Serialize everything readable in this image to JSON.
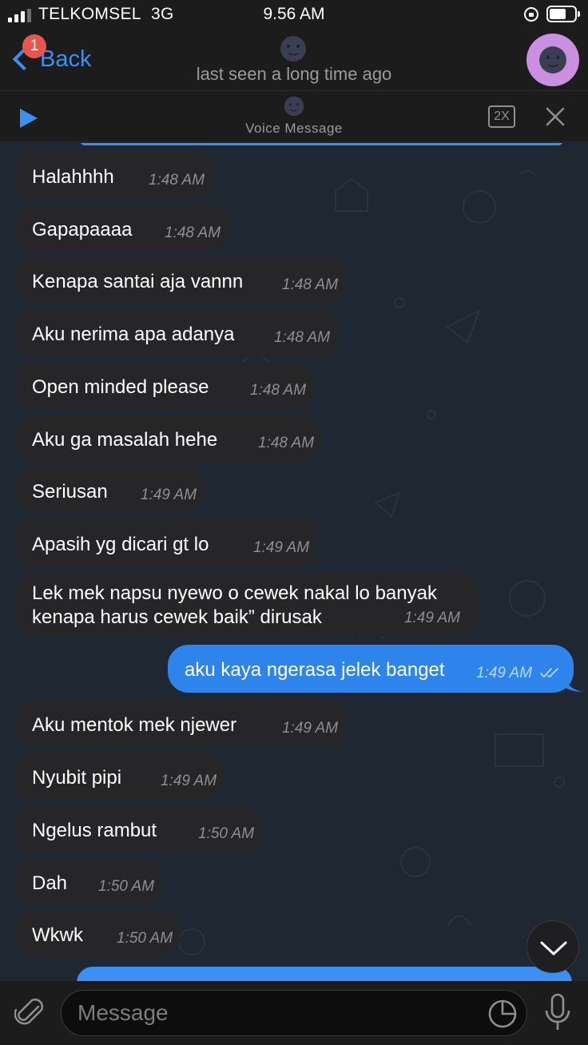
{
  "status_bar": {
    "carrier": "TELKOMSEL",
    "network": "3G",
    "time": "9.56 AM",
    "icons": [
      "signal-icon",
      "orientation-lock-icon",
      "battery-icon"
    ]
  },
  "nav": {
    "back_label": "Back",
    "unread_badge": "1",
    "contact_emoji": "🌚",
    "status": "last seen a long time ago",
    "avatar_emoji": "🌚"
  },
  "voice_bar": {
    "emoji": "🌚",
    "label": "Voice Message",
    "speed": "2X",
    "icons": [
      "play-icon",
      "close-icon"
    ]
  },
  "messages": [
    {
      "dir": "in",
      "text": "Halahhhh",
      "time": "1:48 AM"
    },
    {
      "dir": "in",
      "text": "Gapapaaaa",
      "time": "1:48 AM"
    },
    {
      "dir": "in",
      "text": "Kenapa santai aja vannn",
      "time": "1:48 AM"
    },
    {
      "dir": "in",
      "text": "Aku nerima apa adanya",
      "time": "1:48 AM"
    },
    {
      "dir": "in",
      "text": "Open minded please",
      "time": "1:48 AM"
    },
    {
      "dir": "in",
      "text": "Aku ga masalah hehe",
      "time": "1:48 AM"
    },
    {
      "dir": "in",
      "text": "Seriusan",
      "time": "1:49 AM"
    },
    {
      "dir": "in",
      "text": "Apasih yg dicari gt lo",
      "time": "1:49 AM"
    },
    {
      "dir": "in",
      "line1": "Lek mek napsu nyewo o cewek nakal lo banyak",
      "line2": "kenapa harus cewek baik” dirusak",
      "time": "1:49 AM"
    },
    {
      "dir": "out",
      "text": "aku kaya ngerasa jelek banget",
      "time": "1:49 AM",
      "read": true
    },
    {
      "dir": "in",
      "text": "Aku mentok mek njewer",
      "time": "1:49 AM"
    },
    {
      "dir": "in",
      "text": "Nyubit pipi",
      "time": "1:49 AM"
    },
    {
      "dir": "in",
      "text": "Ngelus rambut",
      "time": "1:50 AM"
    },
    {
      "dir": "in",
      "text": "Dah",
      "time": "1:50 AM"
    },
    {
      "dir": "in",
      "text": "Wkwk",
      "time": "1:50 AM"
    }
  ],
  "input": {
    "placeholder": "Message",
    "icons": [
      "paperclip-icon",
      "sticker-icon",
      "microphone-icon",
      "chevron-down-icon"
    ]
  }
}
